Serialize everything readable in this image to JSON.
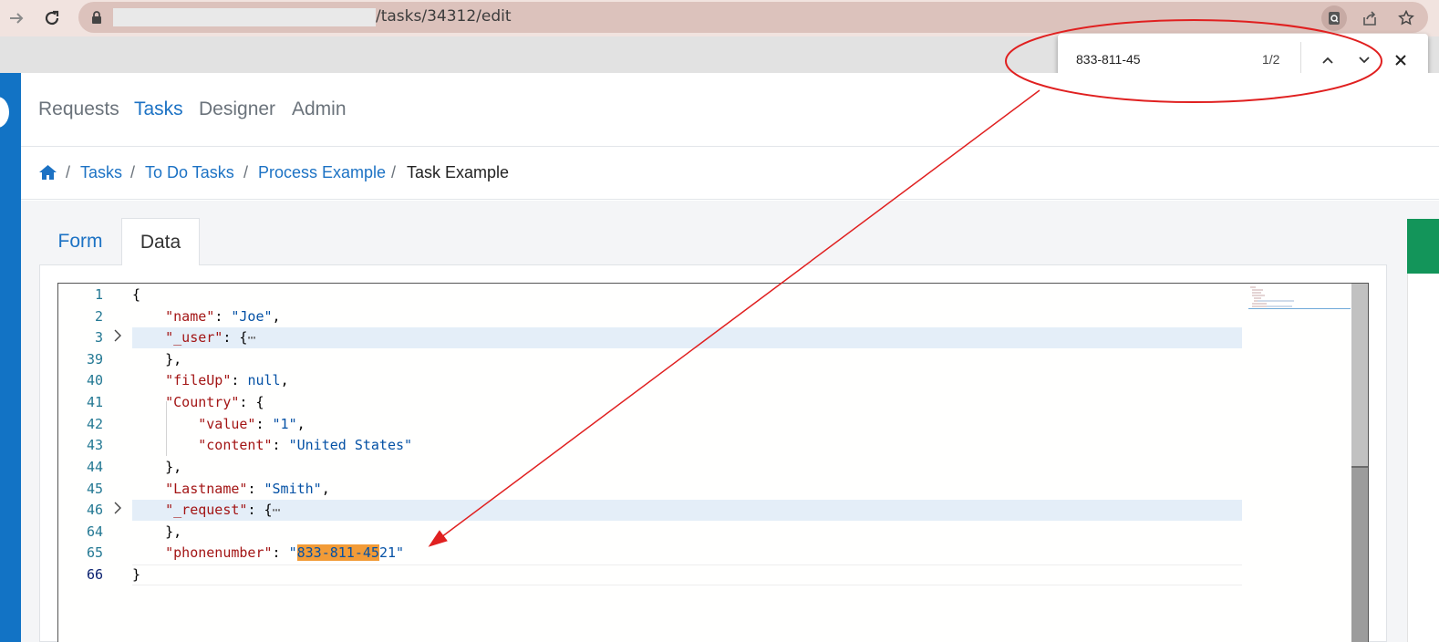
{
  "browser": {
    "url_path": "/tasks/34312/edit",
    "find": {
      "query": "833-811-45",
      "count": "1/2"
    }
  },
  "nav": {
    "items": [
      "Requests",
      "Tasks",
      "Designer",
      "Admin"
    ],
    "active": "Tasks"
  },
  "breadcrumb": [
    "Tasks",
    "To Do Tasks",
    "Process Example"
  ],
  "breadcrumb_current": "Task Example",
  "tabs": {
    "form": "Form",
    "data": "Data",
    "active": "Data"
  },
  "editor": {
    "line_numbers": [
      "1",
      "2",
      "3",
      "39",
      "40",
      "41",
      "42",
      "43",
      "44",
      "45",
      "46",
      "64",
      "65",
      "66"
    ],
    "current_line": "66",
    "lines": {
      "l1_brace": "{",
      "name_key": "\"name\"",
      "name_val": "\"Joe\"",
      "user_key": "\"_user\"",
      "fold_ellipsis": "⋯",
      "close_obj": "},",
      "fileup_key": "\"fileUp\"",
      "fileup_val": "null",
      "country_key": "\"Country\"",
      "value_key": "\"value\"",
      "value_val": "\"1\"",
      "content_key": "\"content\"",
      "content_val": "\"United States\"",
      "lastname_key": "\"Lastname\"",
      "lastname_val": "\"Smith\"",
      "request_key": "\"_request\"",
      "phone_key": "\"phonenumber\"",
      "phone_quote_open": "\"",
      "phone_match": "833-811-45",
      "phone_rest": "21",
      "phone_quote_close": "\"",
      "l66_brace": "}"
    }
  },
  "colors": {
    "accent": "#1c72c4",
    "rail": "#1273c5",
    "find_highlight": "#f29b37",
    "annotation": "#e02020",
    "json_key": "#a31515",
    "json_string": "#0451a5"
  }
}
